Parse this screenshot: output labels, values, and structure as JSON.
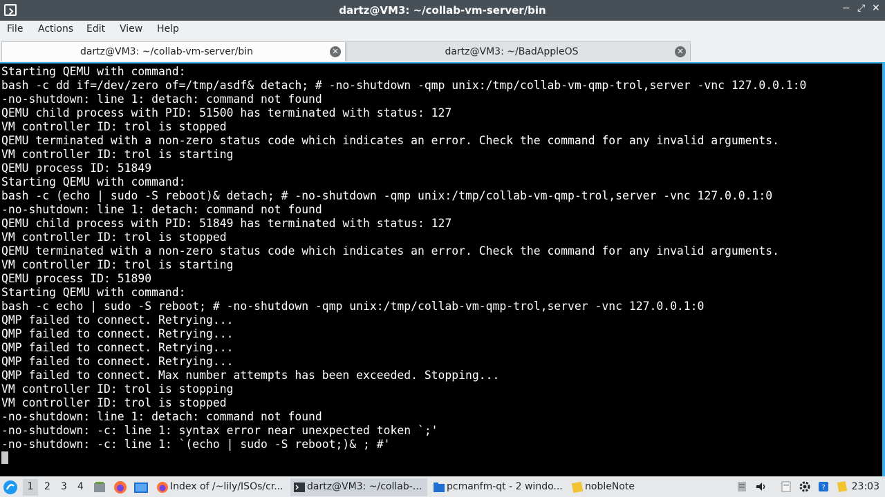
{
  "window": {
    "title": "dartz@VM3: ~/collab-vm-server/bin",
    "controls": {
      "minimize": "−",
      "maximize": "⤢",
      "close": "✕"
    }
  },
  "menu": [
    "File",
    "Actions",
    "Edit",
    "View",
    "Help"
  ],
  "tabs": [
    {
      "label": "dartz@VM3: ~/collab-vm-server/bin",
      "active": true
    },
    {
      "label": "dartz@VM3: ~/BadAppleOS",
      "active": false
    }
  ],
  "terminal": {
    "lines": [
      "Starting QEMU with command:",
      "bash -c dd if=/dev/zero of=/tmp/asdf& detach; # -no-shutdown -qmp unix:/tmp/collab-vm-qmp-trol,server -vnc 127.0.0.1:0",
      "-no-shutdown: line 1: detach: command not found",
      "QEMU child process with PID: 51500 has terminated with status: 127",
      "VM controller ID: trol is stopped",
      "QEMU terminated with a non-zero status code which indicates an error. Check the command for any invalid arguments.",
      "VM controller ID: trol is starting",
      "QEMU process ID: 51849",
      "Starting QEMU with command:",
      "bash -c (echo | sudo -S reboot)& detach; # -no-shutdown -qmp unix:/tmp/collab-vm-qmp-trol,server -vnc 127.0.0.1:0",
      "-no-shutdown: line 1: detach: command not found",
      "QEMU child process with PID: 51849 has terminated with status: 127",
      "VM controller ID: trol is stopped",
      "QEMU terminated with a non-zero status code which indicates an error. Check the command for any invalid arguments.",
      "VM controller ID: trol is starting",
      "QEMU process ID: 51890",
      "Starting QEMU with command:",
      "bash -c echo | sudo -S reboot; # -no-shutdown -qmp unix:/tmp/collab-vm-qmp-trol,server -vnc 127.0.0.1:0",
      "QMP failed to connect. Retrying...",
      "QMP failed to connect. Retrying...",
      "QMP failed to connect. Retrying...",
      "QMP failed to connect. Retrying...",
      "QMP failed to connect. Max number attempts has been exceeded. Stopping...",
      "VM controller ID: trol is stopping",
      "VM controller ID: trol is stopped",
      "-no-shutdown: line 1: detach: command not found",
      "-no-shutdown: -c: line 1: syntax error near unexpected token `;'",
      "-no-shutdown: -c: line 1: `(echo | sudo -S reboot;)& ; #'"
    ]
  },
  "taskbar": {
    "workspaces": [
      "1",
      "2",
      "3",
      "4"
    ],
    "active_workspace": "1",
    "tasks": [
      {
        "label": "Index of /~lily/ISOs/cr...",
        "icon": "firefox-icon"
      },
      {
        "label": "dartz@VM3: ~/collab-...",
        "icon": "terminal-icon",
        "active": true
      },
      {
        "label": "pcmanfm-qt - 2 windo...",
        "icon": "folder-icon"
      },
      {
        "label": "nobleNote",
        "icon": "note-icon"
      }
    ],
    "clock": "23:03"
  },
  "colors": {
    "titlebar": "#475057",
    "accent": "#3daee9",
    "terminal_bg": "#000000",
    "terminal_fg": "#ffffff"
  }
}
